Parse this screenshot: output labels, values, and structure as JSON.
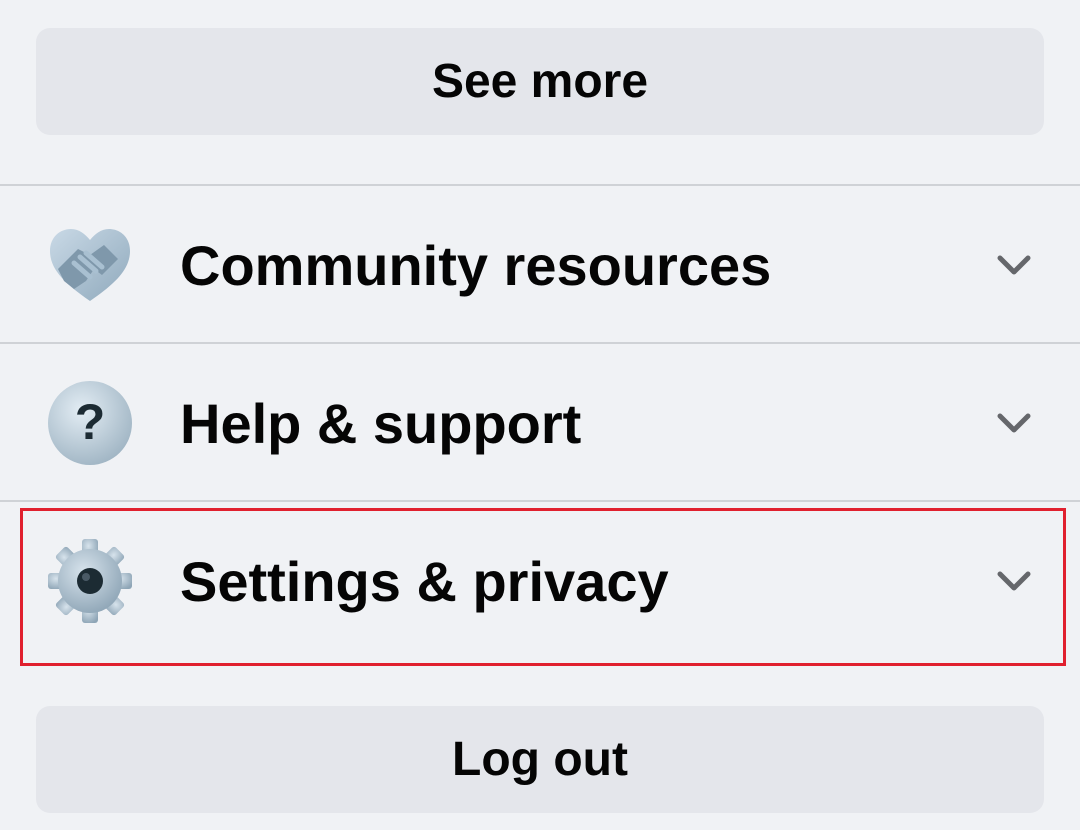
{
  "menu": {
    "see_more_label": "See more",
    "items": [
      {
        "label": "Community resources",
        "icon": "handshake-icon",
        "expand_icon": "chevron-down-icon"
      },
      {
        "label": "Help & support",
        "icon": "question-mark-icon",
        "expand_icon": "chevron-down-icon"
      },
      {
        "label": "Settings & privacy",
        "icon": "gear-icon",
        "expand_icon": "chevron-down-icon",
        "highlighted": true
      }
    ],
    "logout_label": "Log out"
  },
  "colors": {
    "background": "#f0f2f5",
    "button_bg": "#e4e6eb",
    "text": "#050505",
    "chevron": "#65676b",
    "highlight_border": "#e0202e",
    "icon_gray": "#9ab0c0"
  }
}
